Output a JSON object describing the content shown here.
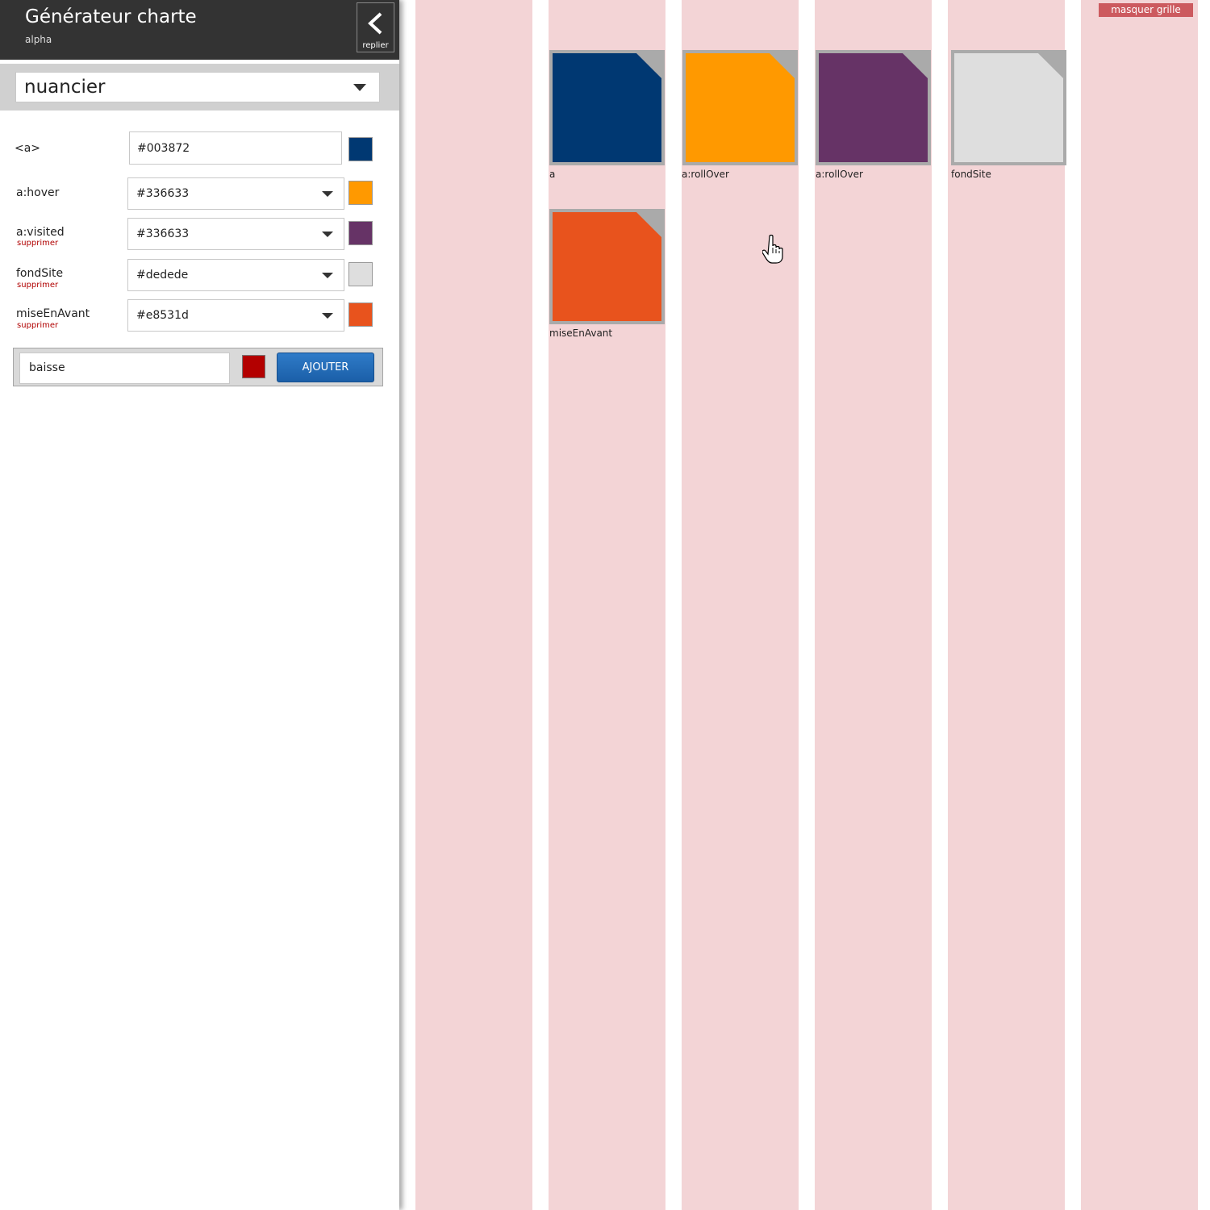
{
  "header": {
    "title": "Générateur charte",
    "subtitle": "alpha",
    "collapse_label": "replier"
  },
  "mode_select": {
    "value": "nuancier"
  },
  "rows": [
    {
      "label": "<a>",
      "value": "#003872",
      "color": "#003872",
      "delete": ""
    },
    {
      "label": "a:hover",
      "value": "#336633",
      "color": "#ff9900",
      "delete": ""
    },
    {
      "label": "a:visited",
      "value": "#336633",
      "color": "#663366",
      "delete": "supprimer"
    },
    {
      "label": "fondSite",
      "value": "#dedede",
      "color": "#dedede",
      "delete": "supprimer"
    },
    {
      "label": "miseEnAvant",
      "value": "#e8531d",
      "color": "#e8531d",
      "delete": "supprimer"
    }
  ],
  "add_form": {
    "name_value": "baisse",
    "color": "#b30000",
    "button_label": "AJOUTER"
  },
  "tiles": [
    {
      "label": "a",
      "color": "#003872"
    },
    {
      "label": "a:rollOver",
      "color": "#ff9900"
    },
    {
      "label": "a:rollOver",
      "color": "#663366"
    },
    {
      "label": "fondSite",
      "color": "#dedede"
    },
    {
      "label": "miseEnAvant",
      "color": "#e8531d"
    }
  ],
  "grid_toggle": {
    "label": "masquer grille"
  },
  "colors": {
    "grid": "#f3d4d6",
    "header": "#333333",
    "accent": "#1b5fa8",
    "delete_link": "#b00000"
  }
}
